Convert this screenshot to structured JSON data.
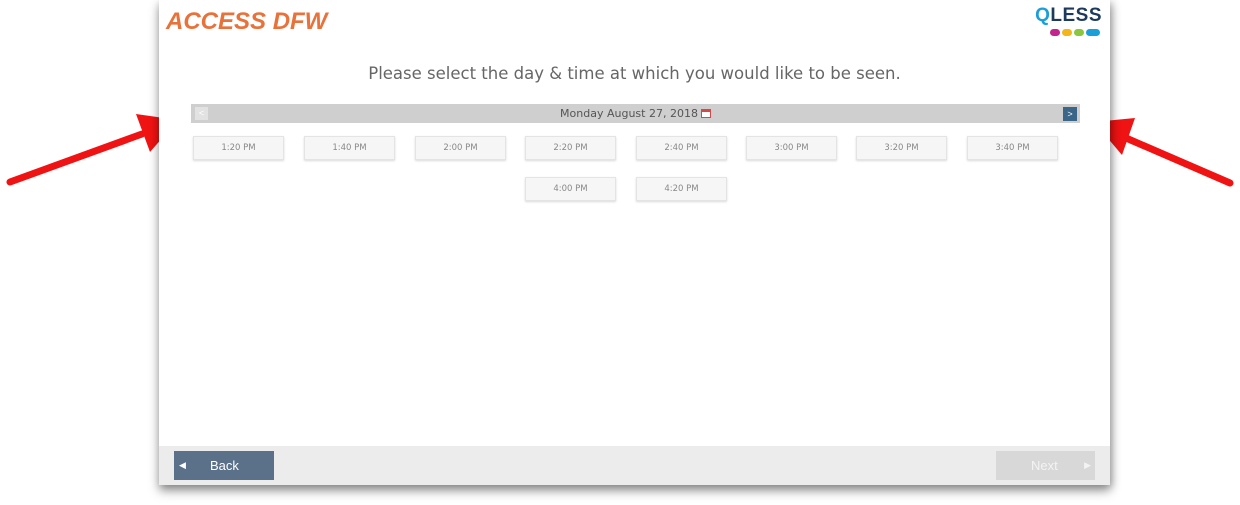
{
  "header": {
    "brand": "ACCESS DFW",
    "qless_logo": {
      "q": "Q",
      "rest": "LESS",
      "dot_colors": [
        "#c2258e",
        "#f2b51c",
        "#8ac640",
        "#1a9fd9"
      ]
    }
  },
  "main": {
    "prompt": "Please select the day & time at which you would like to be seen.",
    "date_bar": {
      "prev_label": "<",
      "date": "Monday August 27, 2018",
      "next_label": ">",
      "calendar_icon": "calendar-icon"
    },
    "time_slots": [
      "1:20 PM",
      "1:40 PM",
      "2:00 PM",
      "2:20 PM",
      "2:40 PM",
      "3:00 PM",
      "3:20 PM",
      "3:40 PM",
      "4:00 PM",
      "4:20 PM"
    ]
  },
  "footer": {
    "back_label": "Back",
    "next_label": "Next"
  },
  "annotations": {
    "arrow_color": "#f01313"
  },
  "colors": {
    "brand": "#e9713a",
    "accent": "#3b6688",
    "back_button": "#5a7189"
  }
}
